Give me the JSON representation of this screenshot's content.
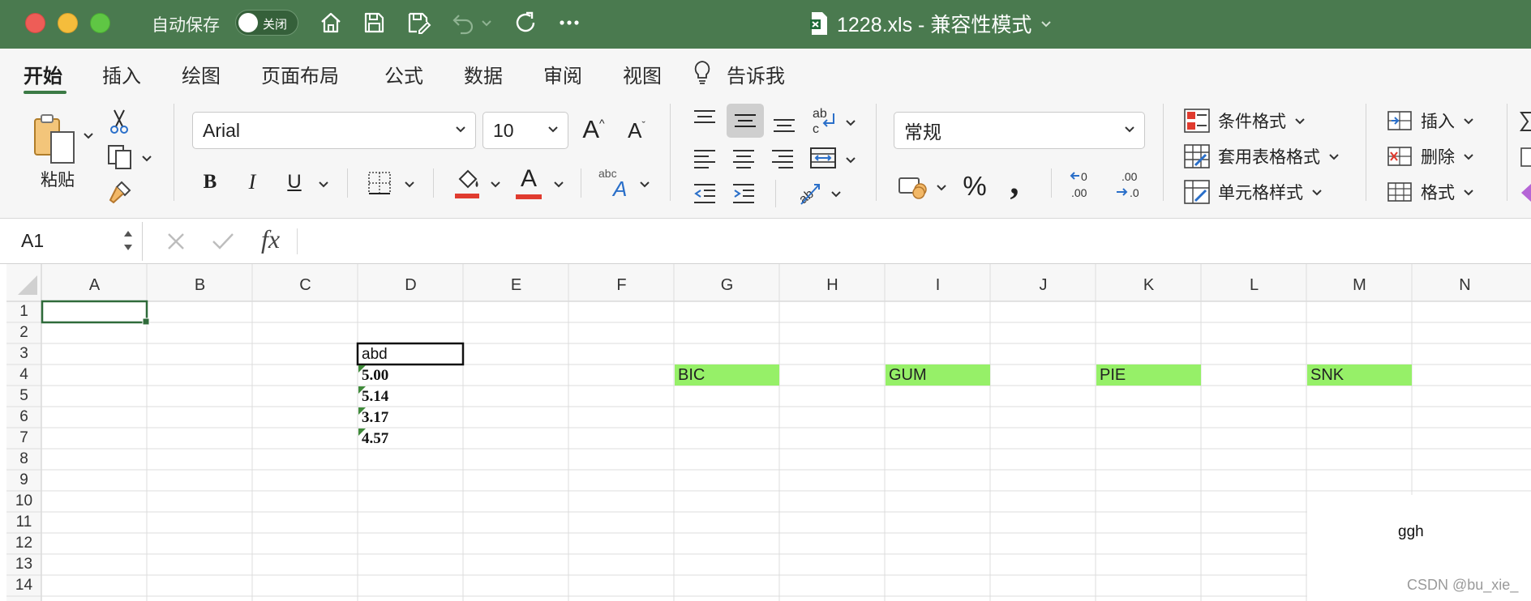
{
  "titlebar": {
    "autosave_label": "自动保存",
    "toggle_state": "关闭",
    "document_title": "1228.xls  -  兼容性模式"
  },
  "tabs": [
    "开始",
    "插入",
    "绘图",
    "页面布局",
    "公式",
    "数据",
    "审阅",
    "视图",
    "告诉我"
  ],
  "ribbon": {
    "paste_label": "粘贴",
    "font_name": "Arial",
    "font_size": "10",
    "number_format": "常规",
    "bold": "B",
    "italic": "I",
    "underline": "U",
    "grow_font": "A",
    "shrink_font": "A",
    "percent": "%",
    "comma": ",",
    "abc": "abc",
    "font_color_letter": "A",
    "conditional_format": "条件格式",
    "format_as_table": "套用表格格式",
    "cell_styles": "单元格样式",
    "insert": "插入",
    "delete": "删除",
    "format": "格式"
  },
  "formula_bar": {
    "name_box": "A1",
    "fx": "fx",
    "formula": ""
  },
  "sheet": {
    "columns": [
      "A",
      "B",
      "C",
      "D",
      "E",
      "F",
      "G",
      "H",
      "I",
      "J",
      "K",
      "L",
      "M",
      "N"
    ],
    "rows": [
      "1",
      "2",
      "3",
      "4",
      "5",
      "6",
      "7",
      "8",
      "9",
      "10",
      "11",
      "12",
      "13",
      "14"
    ],
    "selected_cell": "A1",
    "cells": {
      "D3": "abd",
      "D4": "5.00",
      "D5": "5.14",
      "D6": "3.17",
      "D7": "4.57",
      "G4": "BIC",
      "I4": "GUM",
      "K4": "PIE",
      "M4": "SNK"
    },
    "floating_label": "ggh",
    "highlight_color": "#96f068"
  },
  "watermark": "CSDN @bu_xie_",
  "colors": {
    "titlebar": "#4a7a4f",
    "ribbon": "#f6f6f6",
    "accent": "#3b7a45"
  }
}
